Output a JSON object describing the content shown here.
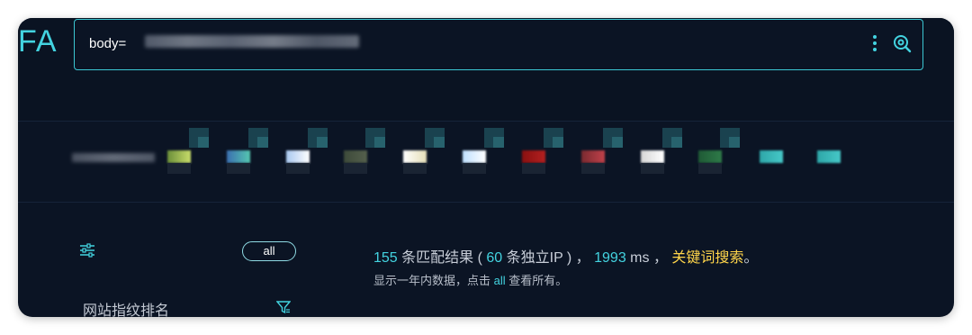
{
  "logo": {
    "text": "FA"
  },
  "search": {
    "query": "body="
  },
  "sidebar": {
    "filter_pill": "all",
    "section_title": "网站指纹排名"
  },
  "results": {
    "count": "155",
    "text1": " 条匹配结果 ( ",
    "ip_count": "60",
    "text2": " 条独立IP ) ， ",
    "time": "1993",
    "text3": " ms ， ",
    "keyword_search": "关键词搜索",
    "text4": "。",
    "sub_prefix": "显示一年内数据，点击 ",
    "sub_link": "all",
    "sub_suffix": " 查看所有。"
  },
  "colors": {
    "accent": "#43d3e0",
    "highlight": "#ffd54a",
    "background": "#0b1424"
  },
  "icons": [
    "more-vertical-icon",
    "search-icon",
    "sliders-icon",
    "funnel-icon"
  ]
}
